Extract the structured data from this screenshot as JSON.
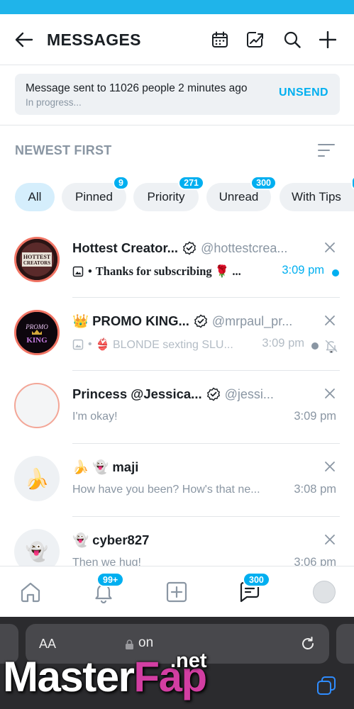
{
  "header": {
    "title": "MESSAGES",
    "icons": [
      "back-arrow-icon",
      "calendar-icon",
      "chart-icon",
      "search-icon",
      "plus-icon"
    ]
  },
  "notice": {
    "text": "Message sent to 11026 people 2 minutes ago",
    "status": "In progress...",
    "action": "UNSEND"
  },
  "sort": {
    "label": "NEWEST FIRST"
  },
  "filters": [
    {
      "label": "All",
      "active": true
    },
    {
      "label": "Pinned",
      "badge": "9"
    },
    {
      "label": "Priority",
      "badge": "271"
    },
    {
      "label": "Unread",
      "badge": "300"
    },
    {
      "label": "With Tips"
    }
  ],
  "conversations": [
    {
      "name": "Hottest Creator...",
      "handle": "@hottestcrea...",
      "avatar_text": "HOTTEST CREATORS",
      "message": "Thanks for subscribing 🌹 ...",
      "message_prefix": "•",
      "time": "3:09 pm",
      "unread": true
    },
    {
      "name": "👑 PROMO KING...",
      "handle": "@mrpaul_pr...",
      "avatar_text": "PROMO KING",
      "message": "👙 BLONDE sexting SLU...",
      "message_prefix": "•",
      "time": "3:09 pm",
      "muted": true
    },
    {
      "name": "Princess @Jessica...",
      "handle": "@jessi...",
      "message": "I'm okay!",
      "time": "3:09 pm"
    },
    {
      "name": "🍌 👻 maji",
      "message": "How have you been? How's that ne...",
      "time": "3:08 pm"
    },
    {
      "name": "👻 cyber827",
      "message": "Then we hug!",
      "time": "3:06 pm"
    }
  ],
  "tabbar": {
    "notifications_badge": "99+",
    "messages_badge": "300"
  },
  "browser": {
    "text_size": "AA",
    "url": "on"
  },
  "watermark": {
    "part1": "Master",
    "part2": "Fap",
    "suffix": ".net"
  },
  "colors": {
    "accent": "#00aff0",
    "muted_text": "#8a96a3",
    "chip_bg": "#eef1f4"
  }
}
